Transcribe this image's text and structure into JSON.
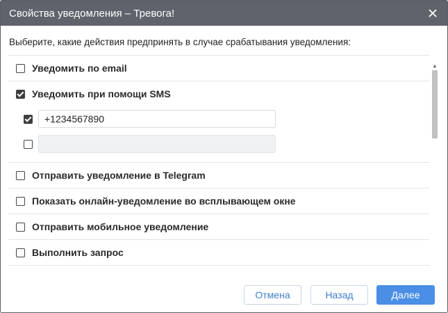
{
  "dialog": {
    "title": "Свойства уведомления – Тревога!",
    "close_icon": "close-icon"
  },
  "intro": "Выберите, какие действия предпринять в случае срабатывания уведомления:",
  "options": [
    {
      "label": "Уведомить по email",
      "checked": false
    },
    {
      "label": "Уведомить при помощи SMS",
      "checked": true
    },
    {
      "label": "Отправить уведомление в Telegram",
      "checked": false
    },
    {
      "label": "Показать онлайн-уведомление во всплывающем окне",
      "checked": false
    },
    {
      "label": "Отправить мобильное уведомление",
      "checked": false
    },
    {
      "label": "Выполнить запрос",
      "checked": false
    }
  ],
  "sms_numbers": [
    {
      "value": "+1234567890",
      "checked": true
    },
    {
      "value": "",
      "checked": false
    }
  ],
  "footer": {
    "cancel_label": "Отмена",
    "back_label": "Назад",
    "next_label": "Далее"
  },
  "colors": {
    "titlebar": "#5f636b",
    "primary": "#4a8ee6",
    "link": "#3f7ecb"
  }
}
